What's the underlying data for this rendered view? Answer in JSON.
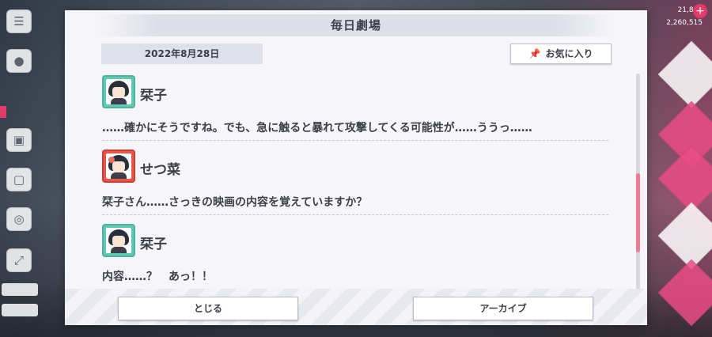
{
  "dialog": {
    "title": "毎日劇場",
    "date": "2022年8月28日",
    "favorite_label": "お気に入り",
    "entries": [
      {
        "speaker": "栞子",
        "avatar": "shioriko",
        "text": "……確かにそうですね。でも、急に触ると暴れて攻撃してくる可能性が……ううっ……"
      },
      {
        "speaker": "せつ菜",
        "avatar": "setsuna",
        "text": "栞子さん……さっきの映画の内容を覚えていますか？"
      },
      {
        "speaker": "栞子",
        "avatar": "shioriko",
        "text": "内容……？　あっ！！"
      }
    ],
    "close_label": "とじる",
    "archive_label": "アーカイブ"
  },
  "background": {
    "resources": [
      "21,882",
      "2,260,515"
    ]
  },
  "colors": {
    "accent_pink": "#ee7c93",
    "teal_frame": "#5fcab4",
    "red_frame": "#e8574a"
  },
  "icons": [
    "menu-icon",
    "chat-icon",
    "gift-icon",
    "pin-icon",
    "plus-icon"
  ]
}
